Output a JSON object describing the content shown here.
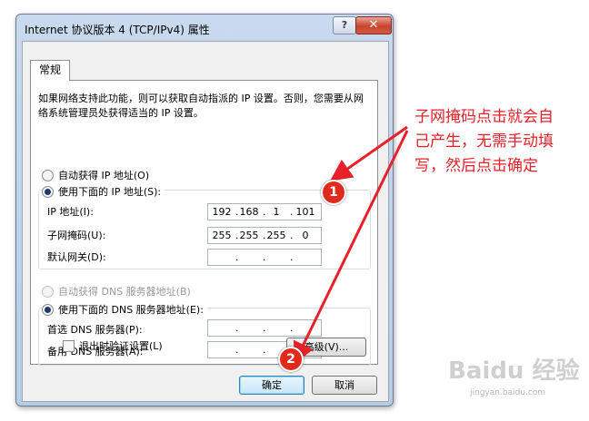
{
  "window": {
    "title": "Internet 协议版本 4 (TCP/IPv4) 属性",
    "help_label": "?",
    "close_label": "✕"
  },
  "tab": {
    "label": "常规"
  },
  "description": "如果网络支持此功能，则可以获取自动指派的 IP 设置。否则，您需要从网络系统管理员处获得适当的 IP 设置。",
  "ip_section": {
    "auto_label": "自动获得 IP 地址(O)",
    "manual_label": "使用下面的 IP 地址(S):",
    "selected": "manual",
    "ip_label": "IP 地址(I):",
    "ip_value": [
      "192",
      "168",
      "1",
      "101"
    ],
    "mask_label": "子网掩码(U):",
    "mask_value": [
      "255",
      "255",
      "255",
      "0"
    ],
    "gateway_label": "默认网关(D):",
    "gateway_value": [
      "",
      "",
      "",
      ""
    ]
  },
  "dns_section": {
    "auto_label": "自动获得 DNS 服务器地址(B)",
    "manual_label": "使用下面的 DNS 服务器地址(E):",
    "selected": "manual",
    "preferred_label": "首选 DNS 服务器(P):",
    "alternate_label": "备用 DNS 服务器(A):"
  },
  "validate_label": "退出时验证设置(L)",
  "advanced_label": "高级(V)...",
  "ok_label": "确定",
  "cancel_label": "取消",
  "annotation": {
    "text": "子网掩码点击就会自己产生，无需手动填写，然后点击确定",
    "badge1": "1",
    "badge2": "2",
    "color": "#e8202a"
  },
  "watermark": {
    "text": "Baidu 经验",
    "sub": "jingyan.baidu.com"
  }
}
